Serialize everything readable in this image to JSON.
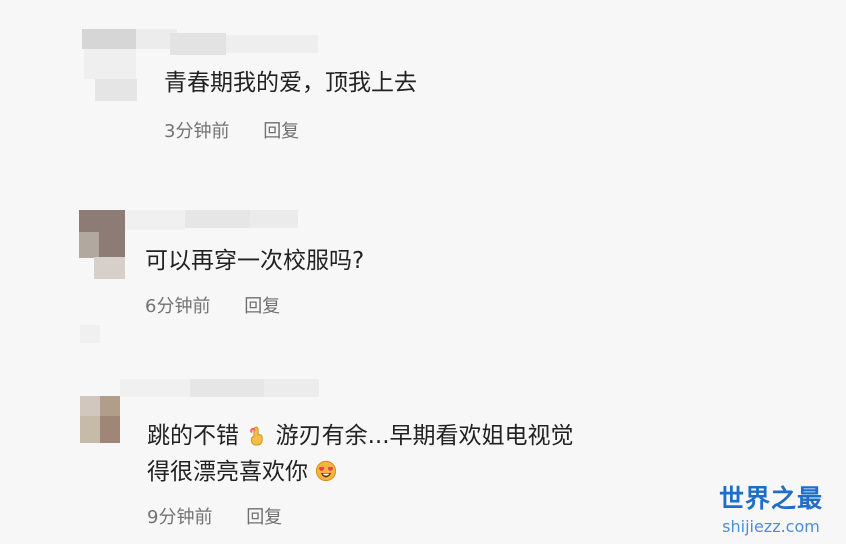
{
  "comments": [
    {
      "text": "青春期我的爱，顶我上去",
      "time": "3分钟前",
      "reply_label": "回复"
    },
    {
      "text": "可以再穿一次校服吗?",
      "time": "6分钟前",
      "reply_label": "回复"
    },
    {
      "text_line1": "跳的不错",
      "text_line1_after": "游刃有余...早期看欢姐电视觉",
      "text_line2": "得很漂亮喜欢你",
      "time": "9分钟前",
      "reply_label": "回复"
    }
  ],
  "watermark": {
    "main": "世界之最",
    "sub": "shijiezz.com"
  },
  "icons": [
    "finger-icon",
    "heart-eyes-icon"
  ],
  "colors": {
    "background": "#f7f7f7",
    "text": "#222222",
    "meta": "#737373",
    "watermark": "#1e6ec8"
  }
}
